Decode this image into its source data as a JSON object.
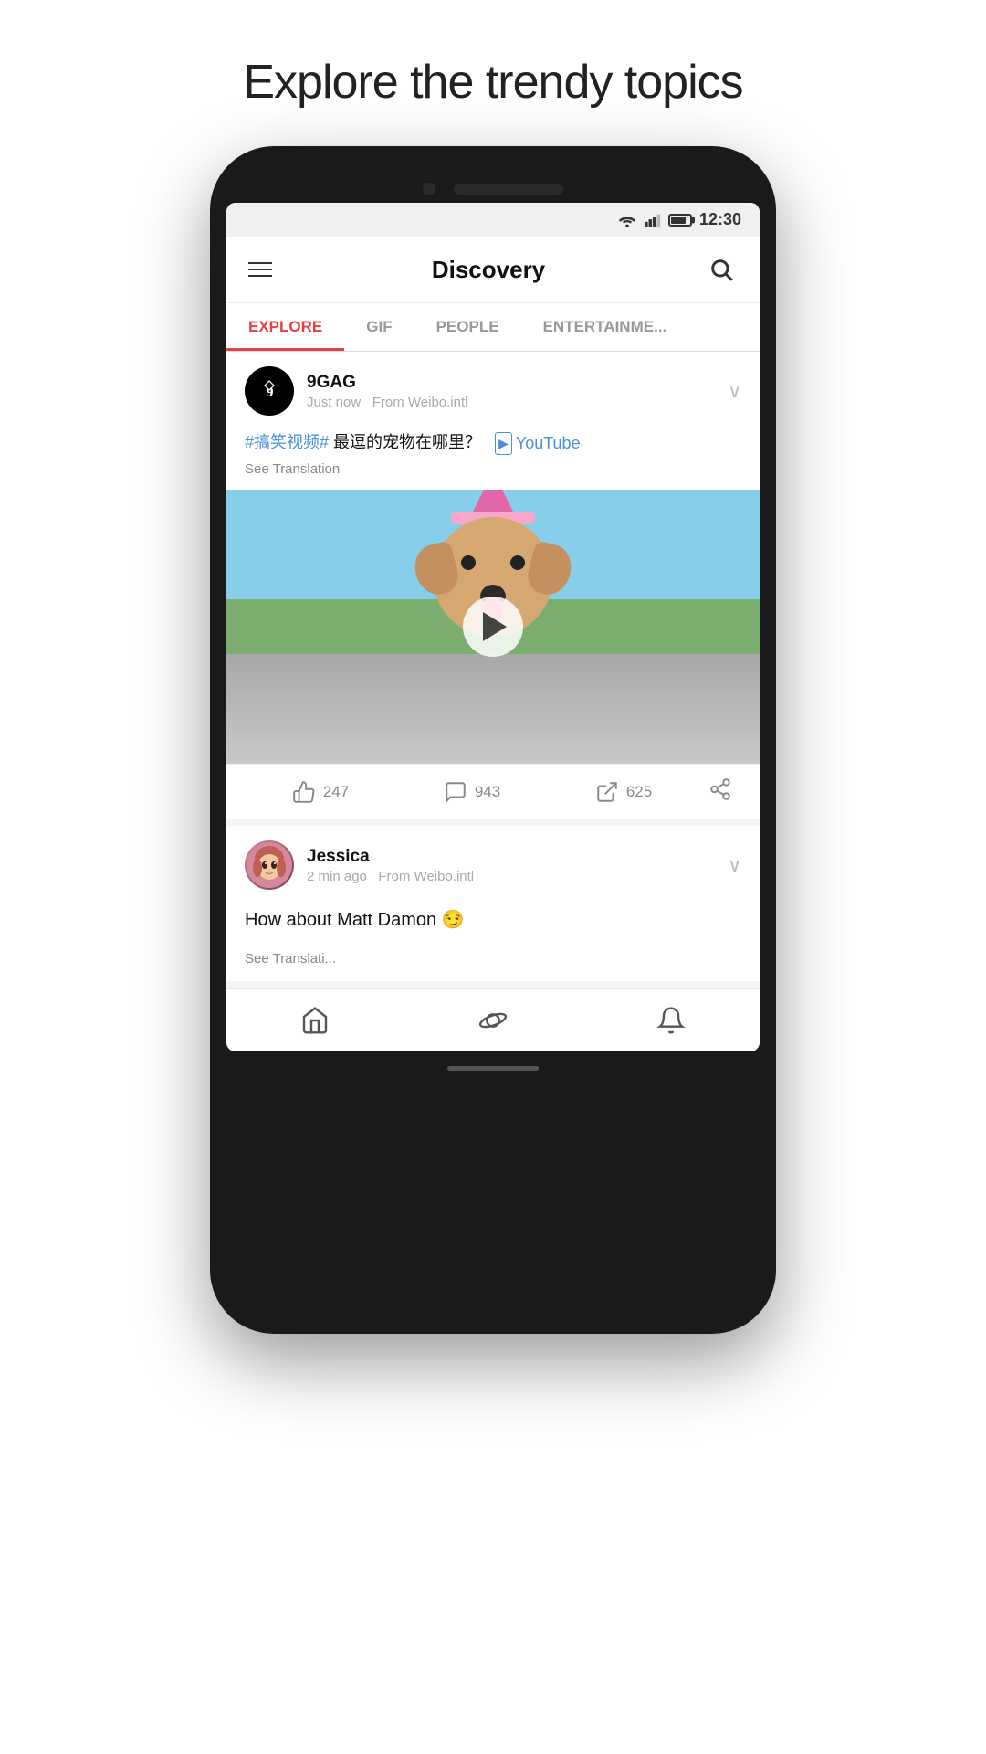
{
  "page": {
    "header_title": "Explore the trendy topics"
  },
  "status_bar": {
    "time": "12:30"
  },
  "app_header": {
    "title": "Discovery",
    "menu_label": "Menu",
    "search_label": "Search"
  },
  "tabs": [
    {
      "id": "explore",
      "label": "EXPLORE",
      "active": true
    },
    {
      "id": "gif",
      "label": "GIF",
      "active": false
    },
    {
      "id": "people",
      "label": "PEOPLE",
      "active": false
    },
    {
      "id": "entertainment",
      "label": "ENTERTAINME...",
      "active": false
    }
  ],
  "posts": [
    {
      "id": "post1",
      "username": "9GAG",
      "meta_time": "Just now",
      "meta_source": "From Weibo.intl",
      "text_hashtag": "#搞笑视频#",
      "text_body": " 最逗的宠物在哪里？",
      "text_youtube": "YouTube",
      "see_translation": "See Translation",
      "likes": "247",
      "comments": "943",
      "shares": "625"
    },
    {
      "id": "post2",
      "username": "Jessica",
      "meta_time": "2 min ago",
      "meta_source": "From Weibo.intl",
      "text_main": "How about Matt Damon 😏",
      "see_translation": "See Translati..."
    }
  ],
  "bottom_nav": [
    {
      "id": "home",
      "label": "Home"
    },
    {
      "id": "discover",
      "label": "Discover"
    },
    {
      "id": "notifications",
      "label": "Notifications"
    }
  ]
}
